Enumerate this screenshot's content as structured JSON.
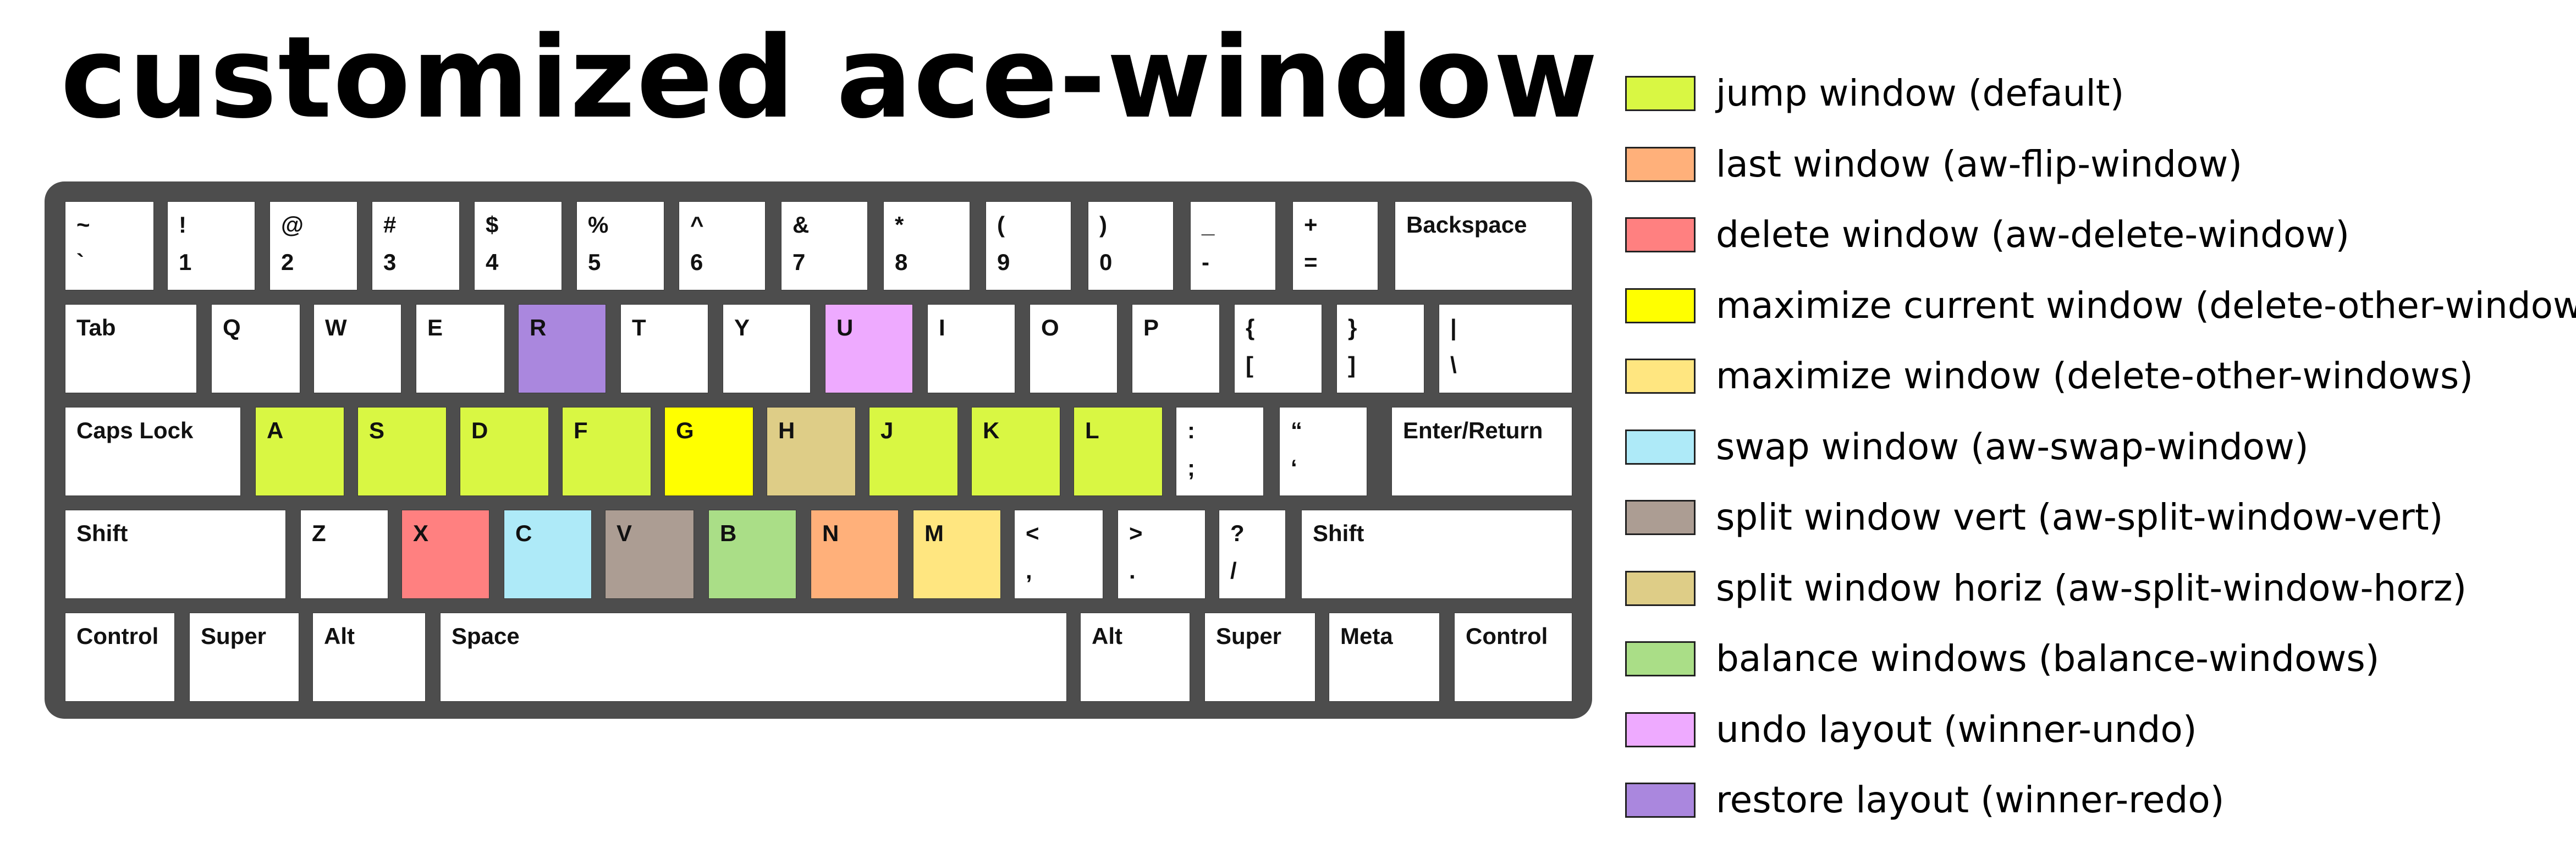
{
  "title": "customized ace-window",
  "colors": {
    "jump": "#d9f743",
    "last": "#ffb07a",
    "delete": "#ff8080",
    "maximize_current": "#ffff00",
    "maximize": "#ffe680",
    "swap": "#aeeaf8",
    "split_vert": "#ac9d93",
    "split_horiz": "#decd87",
    "balance": "#aade87",
    "undo": "#eeaaff",
    "restore": "#aa87de"
  },
  "legend": [
    {
      "label": "jump window (default)",
      "color": "#d9f743"
    },
    {
      "label": "last window (aw-flip-window)",
      "color": "#ffb07a"
    },
    {
      "label": "delete window (aw-delete-window)",
      "color": "#ff8080"
    },
    {
      "label": "maximize current window (delete-other-windows)",
      "color": "#ffff00"
    },
    {
      "label": "maximize window (delete-other-windows)",
      "color": "#ffe680"
    },
    {
      "label": "swap window (aw-swap-window)",
      "color": "#aeeaf8"
    },
    {
      "label": "split window vert (aw-split-window-vert)",
      "color": "#ac9d93"
    },
    {
      "label": "split window horiz (aw-split-window-horz)",
      "color": "#decd87"
    },
    {
      "label": "balance windows (balance-windows)",
      "color": "#aade87"
    },
    {
      "label": "undo layout (winner-undo)",
      "color": "#eeaaff"
    },
    {
      "label": "restore layout (winner-redo)",
      "color": "#aa87de"
    }
  ],
  "rows": [
    [
      {
        "top": "~",
        "bottom": "`"
      },
      {
        "top": "!",
        "bottom": "1"
      },
      {
        "top": "@",
        "bottom": "2"
      },
      {
        "top": "#",
        "bottom": "3"
      },
      {
        "top": "$",
        "bottom": "4"
      },
      {
        "top": "%",
        "bottom": "5"
      },
      {
        "top": "^",
        "bottom": "6"
      },
      {
        "top": "&",
        "bottom": "7"
      },
      {
        "top": "*",
        "bottom": "8"
      },
      {
        "top": "(",
        "bottom": "9"
      },
      {
        "top": ")",
        "bottom": "0"
      },
      {
        "top": "_",
        "bottom": "-"
      },
      {
        "top": "+",
        "bottom": "="
      },
      {
        "top": "Backspace",
        "bottom": ""
      }
    ],
    [
      {
        "top": "Tab",
        "bottom": ""
      },
      {
        "top": "Q",
        "bottom": ""
      },
      {
        "top": "W",
        "bottom": ""
      },
      {
        "top": "E",
        "bottom": ""
      },
      {
        "top": "R",
        "bottom": "",
        "color": "#aa87de"
      },
      {
        "top": "T",
        "bottom": ""
      },
      {
        "top": "Y",
        "bottom": ""
      },
      {
        "top": "U",
        "bottom": "",
        "color": "#eeaaff"
      },
      {
        "top": "I",
        "bottom": ""
      },
      {
        "top": "O",
        "bottom": ""
      },
      {
        "top": "P",
        "bottom": ""
      },
      {
        "top": "{",
        "bottom": "["
      },
      {
        "top": "}",
        "bottom": "]"
      },
      {
        "top": "|",
        "bottom": "\\"
      }
    ],
    [
      {
        "top": "Caps Lock",
        "bottom": ""
      },
      {
        "top": "A",
        "bottom": "",
        "color": "#d9f743"
      },
      {
        "top": "S",
        "bottom": "",
        "color": "#d9f743"
      },
      {
        "top": "D",
        "bottom": "",
        "color": "#d9f743"
      },
      {
        "top": "F",
        "bottom": "",
        "color": "#d9f743"
      },
      {
        "top": "G",
        "bottom": "",
        "color": "#ffff00"
      },
      {
        "top": "H",
        "bottom": "",
        "color": "#decd87"
      },
      {
        "top": "J",
        "bottom": "",
        "color": "#d9f743"
      },
      {
        "top": "K",
        "bottom": "",
        "color": "#d9f743"
      },
      {
        "top": "L",
        "bottom": "",
        "color": "#d9f743"
      },
      {
        "top": ":",
        "bottom": ";"
      },
      {
        "top": "“",
        "bottom": "‘"
      },
      {
        "top": "Enter/Return",
        "bottom": ""
      }
    ],
    [
      {
        "top": "Shift",
        "bottom": ""
      },
      {
        "top": "Z",
        "bottom": ""
      },
      {
        "top": "X",
        "bottom": "",
        "color": "#ff8080"
      },
      {
        "top": "C",
        "bottom": "",
        "color": "#aeeaf8"
      },
      {
        "top": "V",
        "bottom": "",
        "color": "#ac9d93"
      },
      {
        "top": "B",
        "bottom": "",
        "color": "#aade87"
      },
      {
        "top": "N",
        "bottom": "",
        "color": "#ffb07a"
      },
      {
        "top": "M",
        "bottom": "",
        "color": "#ffe680"
      },
      {
        "top": "<",
        "bottom": ","
      },
      {
        "top": ">",
        "bottom": "."
      },
      {
        "top": "?",
        "bottom": "/"
      },
      {
        "top": "Shift",
        "bottom": ""
      }
    ],
    [
      {
        "top": "Control",
        "bottom": ""
      },
      {
        "top": "Super",
        "bottom": ""
      },
      {
        "top": "Alt",
        "bottom": ""
      },
      {
        "top": "Space",
        "bottom": ""
      },
      {
        "top": "Alt",
        "bottom": ""
      },
      {
        "top": "Super",
        "bottom": ""
      },
      {
        "top": "Meta",
        "bottom": ""
      },
      {
        "top": "Control",
        "bottom": ""
      }
    ]
  ]
}
